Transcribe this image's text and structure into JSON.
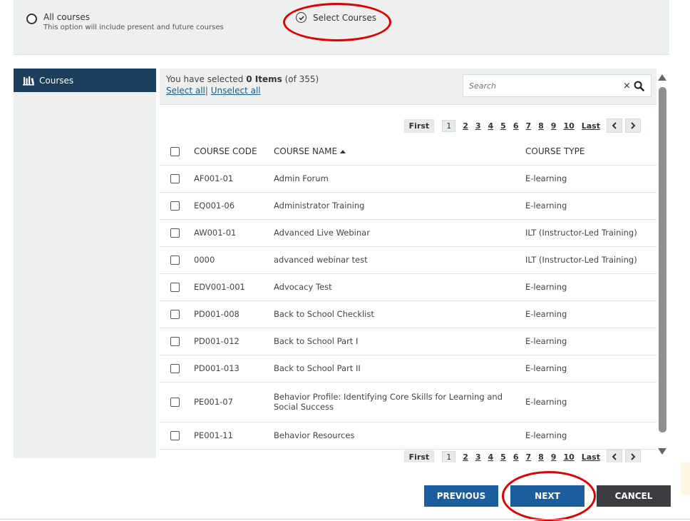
{
  "options": {
    "all_courses": {
      "label": "All courses",
      "description": "This option will include present and future courses"
    },
    "select_courses": {
      "label": "Select Courses"
    }
  },
  "left_panel": {
    "tab_label": "Courses"
  },
  "selection": {
    "prefix": "You have selected ",
    "count": "0 Items",
    "total": " (of 355)",
    "select_all": "Select all",
    "separator": "|",
    "unselect_all": "Unselect all"
  },
  "search": {
    "placeholder": "Search",
    "clear": "×"
  },
  "pagination": {
    "first": "First",
    "pages": [
      "1",
      "2",
      "3",
      "4",
      "5",
      "6",
      "7",
      "8",
      "9",
      "10"
    ],
    "last": "Last"
  },
  "table": {
    "headers": {
      "code": "COURSE CODE",
      "name": "COURSE NAME",
      "type": "COURSE TYPE"
    },
    "rows": [
      {
        "code": "AF001-01",
        "name": "Admin Forum",
        "type": "E-learning"
      },
      {
        "code": "EQ001-06",
        "name": "Administrator Training",
        "type": "E-learning"
      },
      {
        "code": "AW001-01",
        "name": "Advanced Live Webinar",
        "type": "ILT (Instructor-Led Training)"
      },
      {
        "code": "0000",
        "name": "advanced webinar test",
        "type": "ILT (Instructor-Led Training)"
      },
      {
        "code": "EDV001-001",
        "name": "Advocacy Test",
        "type": "E-learning"
      },
      {
        "code": "PD001-008",
        "name": "Back to School Checklist",
        "type": "E-learning"
      },
      {
        "code": "PD001-012",
        "name": "Back to School Part I",
        "type": "E-learning"
      },
      {
        "code": "PD001-013",
        "name": "Back to School Part II",
        "type": "E-learning"
      },
      {
        "code": "PE001-07",
        "name": "Behavior Profile: Identifying Core Skills for Learning and Social Success",
        "type": "E-learning"
      },
      {
        "code": "PE001-11",
        "name": "Behavior Resources",
        "type": "E-learning"
      }
    ]
  },
  "buttons": {
    "previous": "PREVIOUS",
    "next": "NEXT",
    "cancel": "CANCEL"
  },
  "colors": {
    "nav_dark": "#1a3e5c",
    "primary_button": "#1c5d9d",
    "cancel_button": "#3b3d40",
    "highlight_ellipse": "#e10000"
  }
}
